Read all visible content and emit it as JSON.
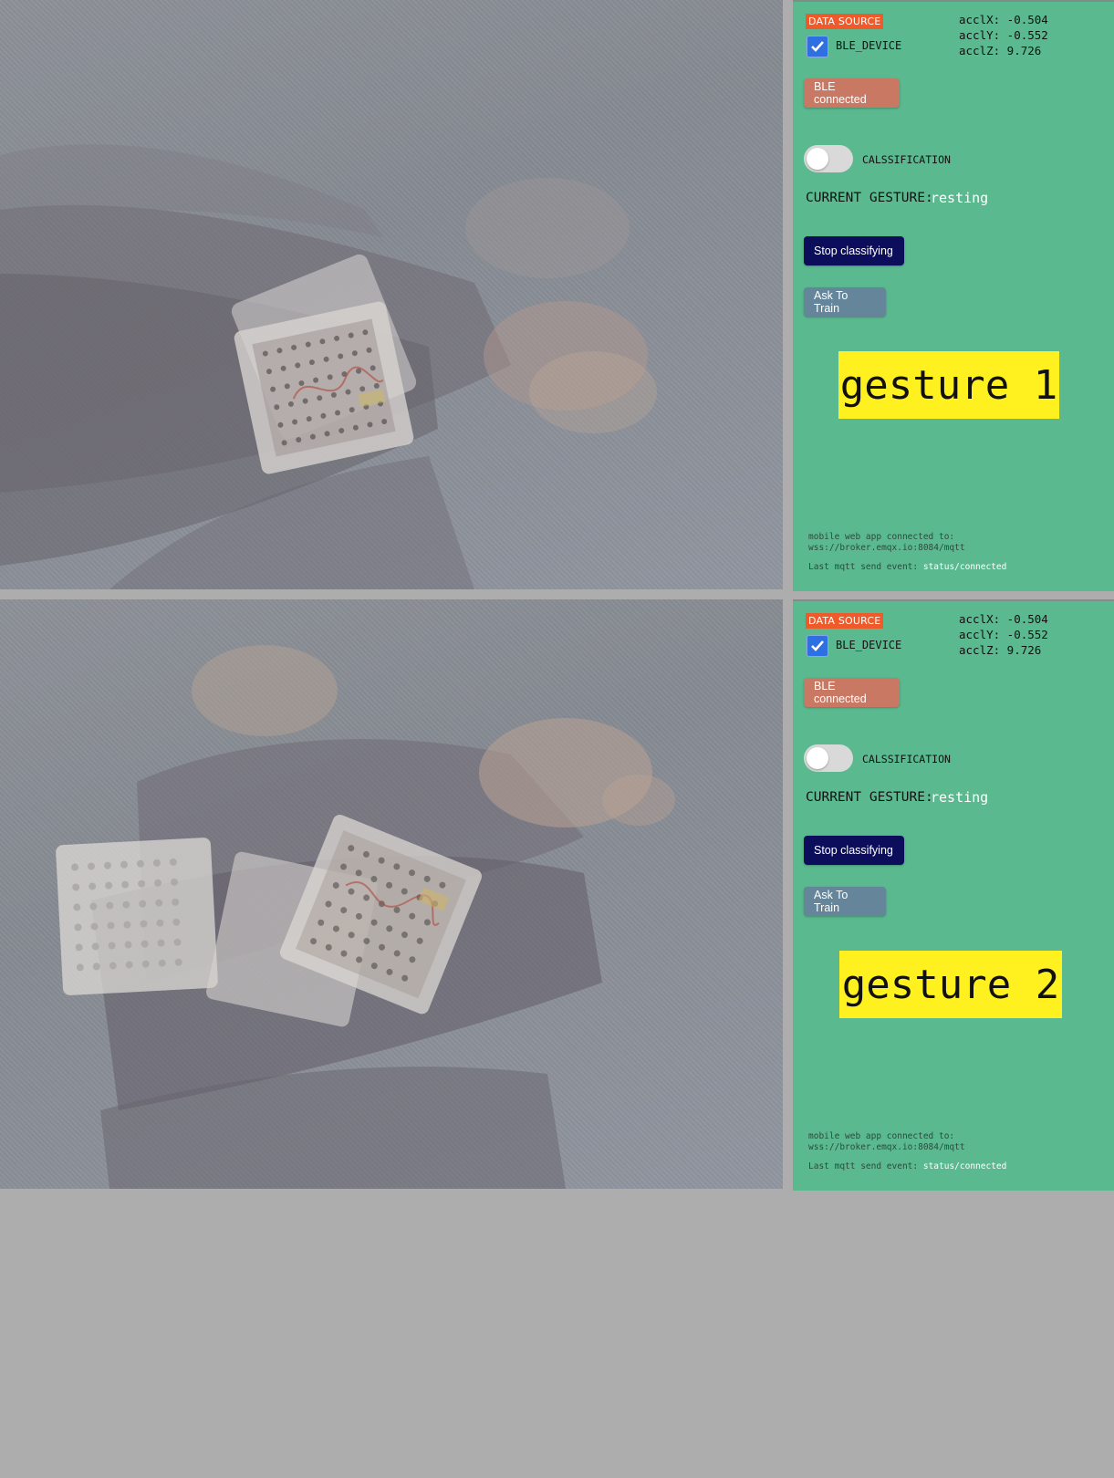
{
  "panels": [
    {
      "data_source_label": "DATA SOURCE",
      "device_label": "BLE_DEVICE",
      "device_checked": true,
      "accl": {
        "x": "acclX: -0.504",
        "y": "acclY: -0.552",
        "z": "acclZ: 9.726"
      },
      "ble_button": "BLE connected",
      "classification_label": "CALSSIFICATION",
      "classification_on": false,
      "current_gesture_label": "CURRENT GESTURE:",
      "current_gesture_value": "resting",
      "stop_button": "Stop classifying",
      "train_button": "Ask To Train",
      "gesture_banner": "gesture 1",
      "footer_line1": "mobile web app connected to:",
      "footer_line2": "wss://broker.emqx.io:8084/mqtt",
      "last_event_label": "Last mqtt send event:",
      "last_event_value": "status/connected"
    },
    {
      "data_source_label": "DATA SOURCE",
      "device_label": "BLE_DEVICE",
      "device_checked": true,
      "accl": {
        "x": "acclX: -0.504",
        "y": "acclY: -0.552",
        "z": "acclZ: 9.726"
      },
      "ble_button": "BLE connected",
      "classification_label": "CALSSIFICATION",
      "classification_on": false,
      "current_gesture_label": "CURRENT GESTURE:",
      "current_gesture_value": "resting",
      "stop_button": "Stop classifying",
      "train_button": "Ask To Train",
      "gesture_banner": "gesture 2",
      "footer_line1": "mobile web app connected to:",
      "footer_line2": "wss://broker.emqx.io:8084/mqtt",
      "last_event_label": "Last mqtt send event:",
      "last_event_value": "status/connected"
    }
  ],
  "photos": [
    {
      "subject": "arm-with-wrist-device-motion-overlay"
    },
    {
      "subject": "arm-with-wrist-device-motion-overlay"
    }
  ],
  "colors": {
    "panel_bg": "#5bb98f",
    "data_source_badge": "#ef5a2a",
    "ble_button": "#c97864",
    "stop_button": "#0c0e5c",
    "train_button": "#64859a",
    "gesture_banner": "#fff11f"
  }
}
